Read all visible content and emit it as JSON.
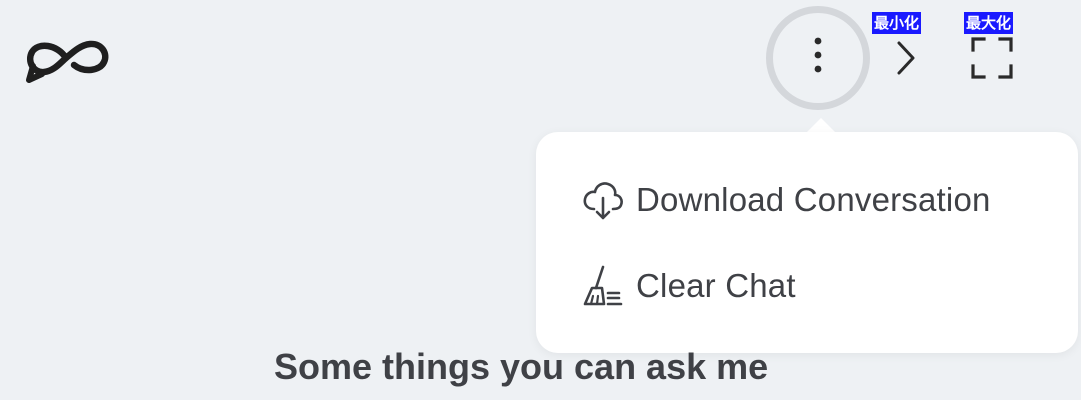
{
  "header": {
    "logo_icon": "infinity-logo-icon",
    "more_icon": "vertical-dots-icon",
    "minimize_icon": "chevron-right-icon",
    "maximize_icon": "expand-corners-icon",
    "minimize_tooltip": "最小化",
    "maximize_tooltip": "最大化"
  },
  "menu": {
    "items": [
      {
        "label": "Download Conversation",
        "icon": "cloud-download-icon"
      },
      {
        "label": "Clear Chat",
        "icon": "broom-icon"
      }
    ]
  },
  "main": {
    "heading": "Some things you can ask me"
  },
  "colors": {
    "background": "#eef1f4",
    "menu_background": "#ffffff",
    "text": "#3f4146",
    "tooltip_background": "#1a1aff",
    "tooltip_text": "#ffffff",
    "focus_ring": "#d4d7db"
  }
}
